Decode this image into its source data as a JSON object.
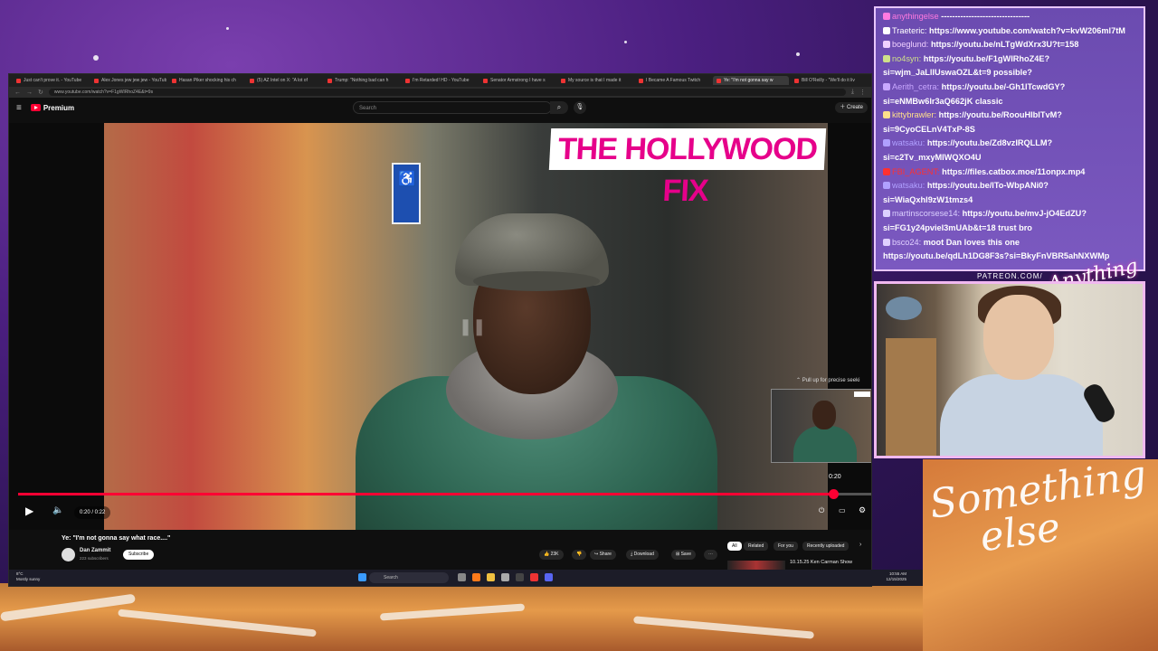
{
  "browser": {
    "tabs": [
      {
        "label": "Just can't prove it. - YouTube",
        "active": false
      },
      {
        "label": "Alex Jones jew jew jew - YouTube",
        "active": false
      },
      {
        "label": "Hasan Piker shocking his ch",
        "active": false
      },
      {
        "label": "(5) AZ Intel on X: \"A lot of",
        "active": false
      },
      {
        "label": "Trump: \"Nothing bad can h",
        "active": false
      },
      {
        "label": "I'm Retarded! HD - YouTube",
        "active": false
      },
      {
        "label": "Senator Armstrong I have s",
        "active": false
      },
      {
        "label": "My source is that I made it",
        "active": false
      },
      {
        "label": "I Became A Famous Twitch",
        "active": false
      },
      {
        "label": "Ye: \"I'm not gonna say w",
        "active": true
      },
      {
        "label": "Bill O'Reilly - \"We'll do it liv",
        "active": false
      }
    ],
    "url": "www.youtube.com/watch?v=F1gWIRhoZ4E&t=9s"
  },
  "youtube": {
    "logo": "Premium",
    "search_placeholder": "Search",
    "create_label": "Create",
    "overlay_logo": "THE HOLLYWOOD FIX",
    "pullup_hint": "Pull up for precise seeki",
    "hover_time": "0:20",
    "time_display": "0:20 / 0:22",
    "progress_fraction": 0.91,
    "video_title": "Ye: \"I'm not gonna say what race....\"",
    "channel_name": "Dan Zammit",
    "channel_subs": "223 subscribers",
    "subscribe_label": "Subscribe",
    "likes": "23K",
    "share_label": "Share",
    "download_label": "Download",
    "save_label": "Save",
    "chips": [
      "All",
      "Related",
      "For you",
      "Recently uploaded"
    ],
    "recommended_title": "10.15.25 Ken Carman Show"
  },
  "taskbar": {
    "weather_temp": "8°C",
    "weather_desc": "Mostly sunny",
    "search_label": "Search",
    "time": "10:55 AM",
    "date": "12/15/2025"
  },
  "chat": {
    "messages": [
      {
        "user": "anythingelse",
        "text": "--------------------------------",
        "user_color": "#ff7ae0"
      },
      {
        "user": "Traeteric:",
        "text": "https://www.youtube.com/watch?v=kvW206ml7tM",
        "user_color": "#ffffff"
      },
      {
        "user": "boeglund:",
        "text": "https://youtu.be/nLTgWdXrx3U?t=158",
        "user_color": "#f0d0ff"
      },
      {
        "user": "no4syn:",
        "text": "https://youtu.be/F1gWIRhoZ4E? si=wjm_JaLlIUswaOZL&t=9 possible?",
        "user_color": "#cfe08a"
      },
      {
        "user": "Aerith_cetra:",
        "text": "https://youtu.be/-Gh1lTcwdGY? si=eNMBw6lr3aQ662jK classic",
        "user_color": "#c9a8ff"
      },
      {
        "user": "kittybrawler:",
        "text": "https://youtu.be/RoouHIbITvM? si=9CyoCELnV4TxP-8S",
        "user_color": "#ffe08a"
      },
      {
        "user": "watsaku:",
        "text": "https://youtu.be/Zd8vzIRQLLM? si=c2Tv_mxyMlWQXO4U",
        "user_color": "#b0a0ff"
      },
      {
        "user": "FBI_AGENT:",
        "text": "https://files.catbox.moe/11onpx.mp4",
        "user_color": "#ff3030"
      },
      {
        "user": "watsaku:",
        "text": "https://youtu.be/lTo-WbpANi0? si=WiaQxhl9zW1tmzs4",
        "user_color": "#b0a0ff"
      },
      {
        "user": "martinscorsese14:",
        "text": "https://youtu.be/mvJ-jO4EdZU? si=FG1y24pviel3mUAb&t=18 trust bro",
        "user_color": "#dcd0ff"
      },
      {
        "user": "bsco24:",
        "text": "moot Dan loves this one https://youtu.be/qdLh1DG8F3s?si=BkyFnVBR5ahNXWMp",
        "user_color": "#e0d0ff"
      }
    ]
  },
  "overlay": {
    "patreon": "PATREON.COM/",
    "anything_logo": "Anything else",
    "something_line1": "Something",
    "something_line2": "else"
  },
  "colors": {
    "yt_red": "#ff0033",
    "chat_bg": "#7b59c0",
    "hollywood_pink": "#e6008a"
  }
}
